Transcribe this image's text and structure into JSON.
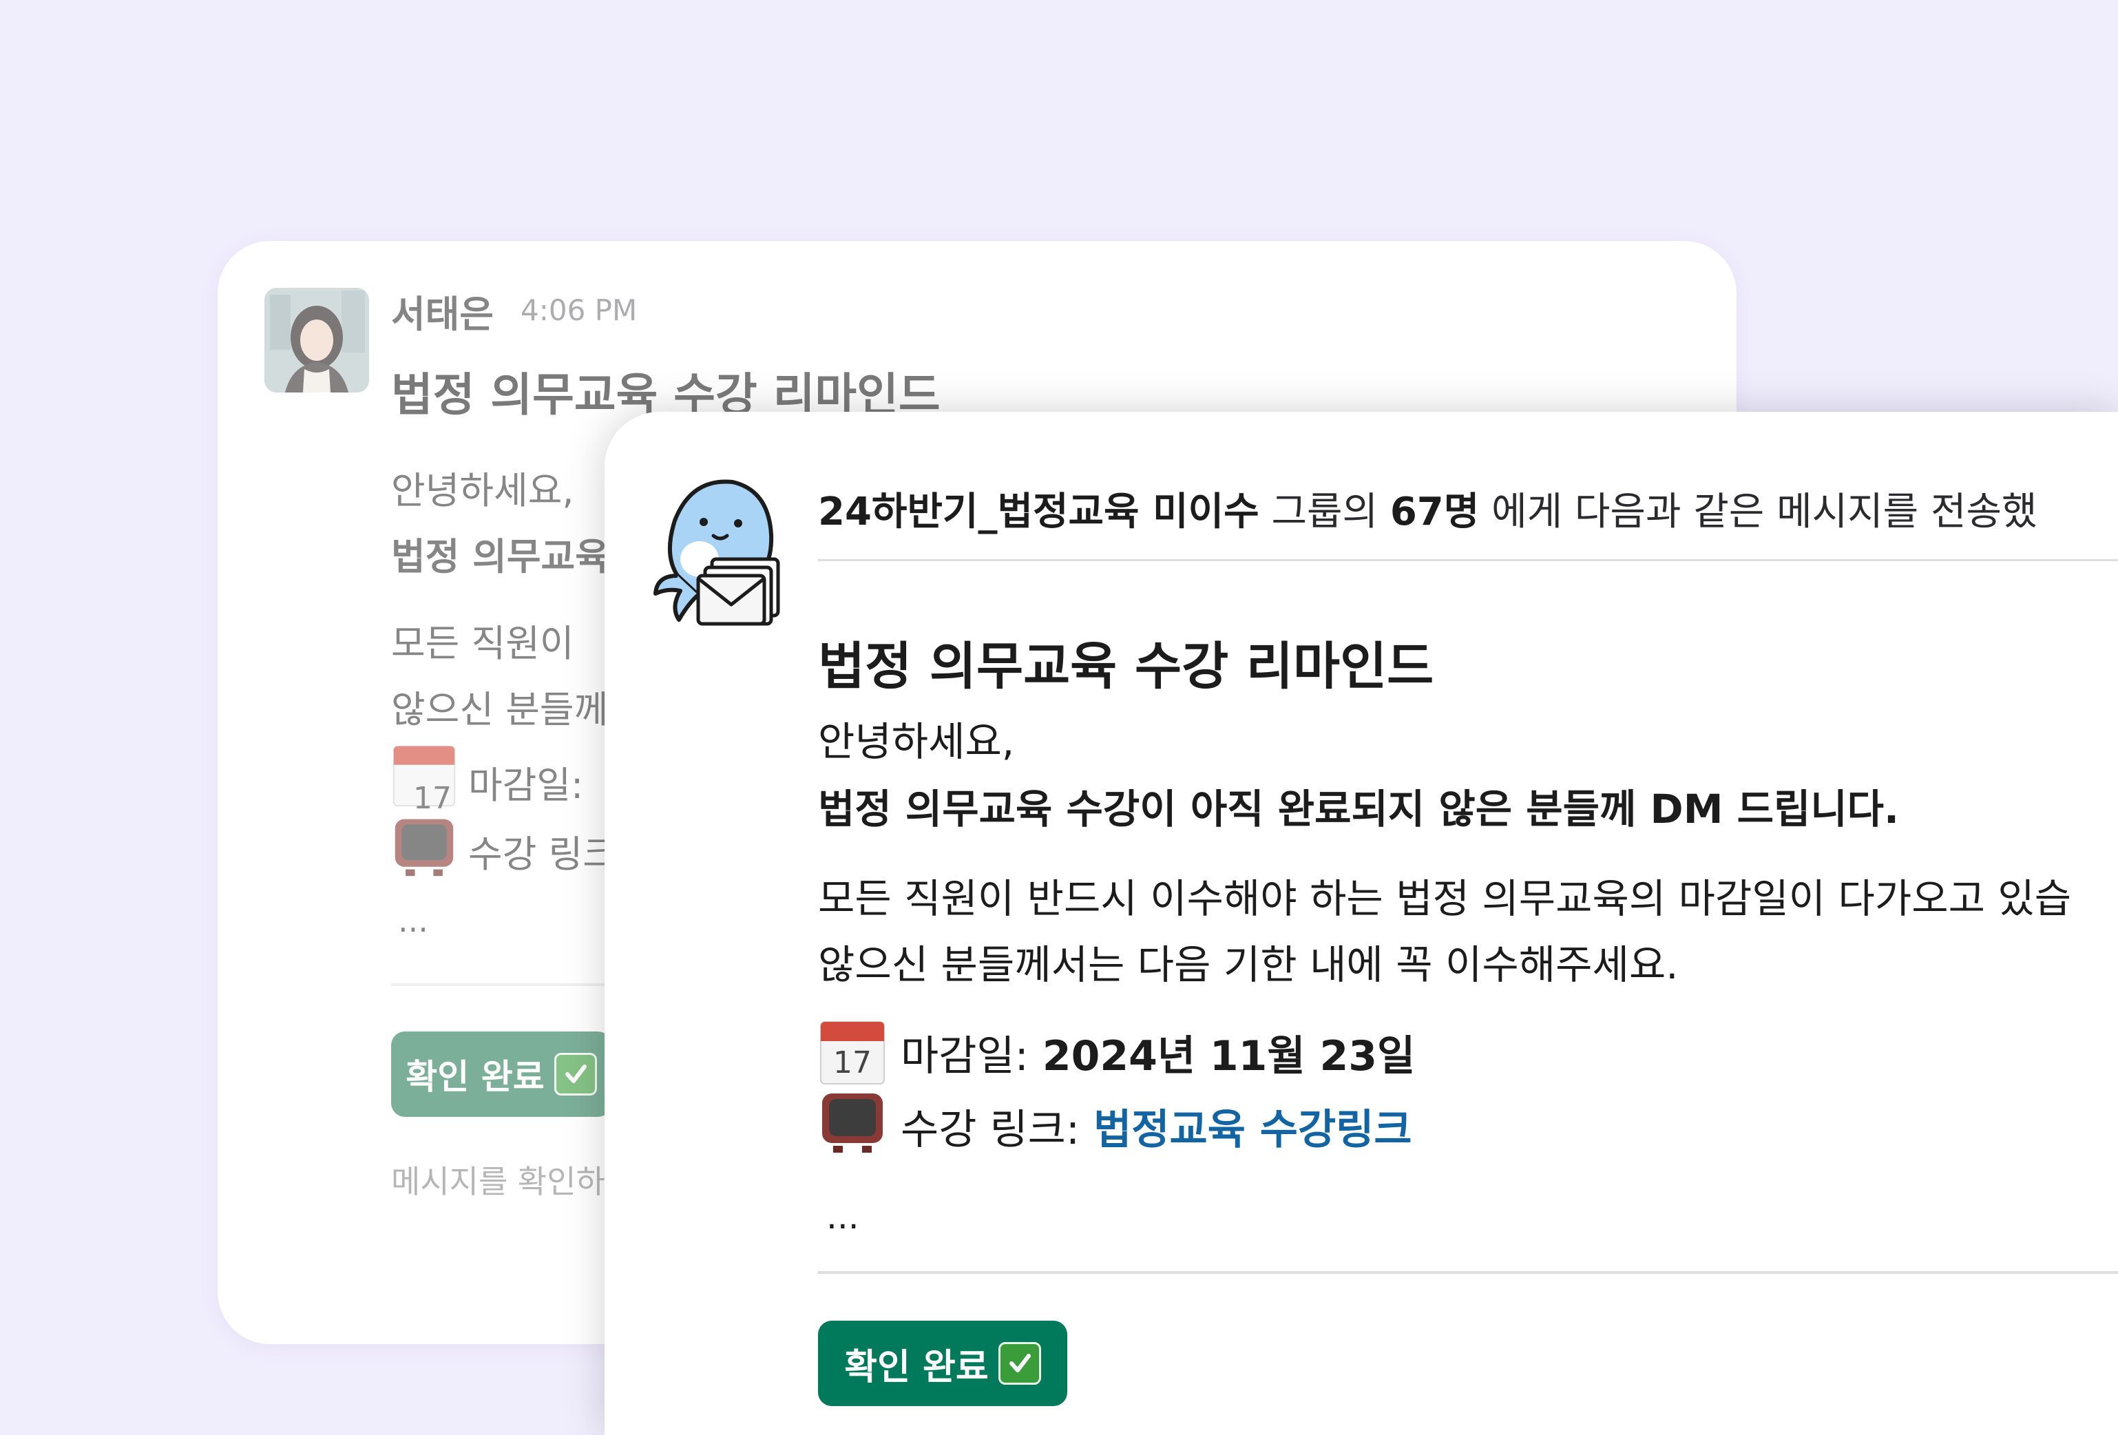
{
  "colors": {
    "page_background": "#f0edfd",
    "button_green": "#007a5a",
    "link_blue": "#1264a3"
  },
  "back_message": {
    "sender": "서태은",
    "time": "4:06 PM",
    "title": "법정 의무교육 수강 리마인드",
    "greeting": "안녕하세요,",
    "bold_line": "법정 의무교육",
    "body_line1": "모든 직원이",
    "body_line2": "않으신 분들께",
    "deadline_label": "마감일:",
    "link_label": "수강 링크",
    "ellipsis": "...",
    "button_label": "확인 완료",
    "footer": "메시지를 확인하"
  },
  "front_message": {
    "header": {
      "group": "24하반기_법정교육 미이수",
      "text1": " 그룹의 ",
      "count": "67명",
      "text2": " 에게 다음과 같은 메시지를 전송했"
    },
    "title": "법정 의무교육 수강 리마인드",
    "greeting": "안녕하세요,",
    "bold_line": "법정 의무교육 수강이 아직 완료되지 않은 분들께 DM 드립니다.",
    "body_line1": "모든 직원이 반드시 이수해야 하는 법정 의무교육의 마감일이 다가오고 있습",
    "body_line2": "않으신 분들께서는 다음 기한 내에 꼭 이수해주세요.",
    "deadline_label": "마감일:",
    "deadline_value": "2024년 11월 23일",
    "link_label": "수강 링크:",
    "link_text": "법정교육 수강링크",
    "ellipsis": "...",
    "button_label": "확인 완료"
  },
  "icons": {
    "calendar": "calendar-icon",
    "tv": "television-icon",
    "check": "check-mark-icon",
    "mascot": "dolphin-mascot-icon"
  },
  "calendar_day": "17"
}
